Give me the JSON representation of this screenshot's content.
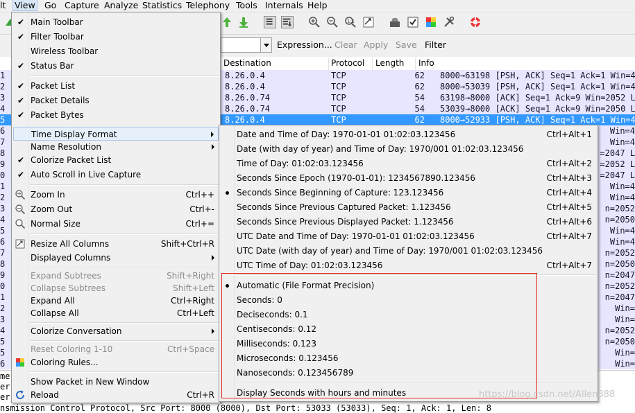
{
  "menubar": {
    "items": [
      "lt",
      "View",
      "Go",
      "Capture",
      "Analyze",
      "Statistics",
      "Telephony",
      "Tools",
      "Internals",
      "Help"
    ]
  },
  "filter": {
    "expression_label": "Expression...",
    "clear_label": "Clear",
    "apply_label": "Apply",
    "save_label": "Save",
    "filter_label": "Filter"
  },
  "packet_list": {
    "columns": [
      "Destination",
      "Protocol",
      "Length",
      "Info"
    ],
    "rows": [
      {
        "no": "1",
        "dest": "8.26.0.4",
        "proto": "TCP",
        "len": "62",
        "info": "8000→63198 [PSH, ACK] Seq=1 Ack=1 Win=4"
      },
      {
        "no": "2",
        "dest": "8.26.0.4",
        "proto": "TCP",
        "len": "62",
        "info": "8000→53039 [PSH, ACK] Seq=1 Ack=1 Win=4"
      },
      {
        "no": "3",
        "dest": "8.26.0.74",
        "proto": "TCP",
        "len": "54",
        "info": "63198→8000 [ACK] Seq=1 Ack=9 Win=2052 L"
      },
      {
        "no": "4",
        "dest": "8.26.0.74",
        "proto": "TCP",
        "len": "54",
        "info": "53039→8000 [ACK] Seq=1 Ack=9 Win=2050 L"
      },
      {
        "no": "5",
        "dest": "8.26.0.4",
        "proto": "TCP",
        "len": "62",
        "info": "8000→52933 [PSH, ACK] Seq=1 Ack=1 Win=4"
      },
      {
        "no": "6",
        "info": "Win=4"
      },
      {
        "no": "7",
        "info": "Win=4"
      },
      {
        "no": "8",
        "info": "=2047 L"
      },
      {
        "no": "9",
        "info": "=2052 L"
      },
      {
        "no": "0",
        "info": "=2047 L"
      },
      {
        "no": "1",
        "info": "Win=4"
      },
      {
        "no": "2",
        "info": "Win=4"
      },
      {
        "no": "3",
        "info": "n=2052"
      },
      {
        "no": "4",
        "info": "n=2050"
      },
      {
        "no": "5",
        "info": "Win=4"
      },
      {
        "no": "6",
        "info": "Win=4"
      },
      {
        "no": "7",
        "info": "n=2052"
      },
      {
        "no": "8",
        "info": "n=2050"
      },
      {
        "no": "9",
        "info": "n=2047"
      },
      {
        "no": "0",
        "info": "n=2052"
      },
      {
        "no": "1",
        "info": "n=2047"
      },
      {
        "no": "2",
        "info": "Win="
      },
      {
        "no": "3",
        "info": "Win="
      },
      {
        "no": "4",
        "info": "n=2052"
      },
      {
        "no": "5",
        "info": "n=2050"
      },
      {
        "no": "5",
        "info": "Win="
      },
      {
        "no": "6",
        "info": "Win="
      }
    ]
  },
  "details": {
    "lines": [
      "me",
      "err",
      "err",
      "nsmission Control Protocol, Src Port: 8000 (8000), Dst Port: 53033 (53033), Seq: 1, Ack: 1, Len: 8"
    ]
  },
  "view_menu": {
    "items": [
      {
        "label": "Main Toolbar",
        "checked": true
      },
      {
        "label": "Filter Toolbar",
        "checked": true
      },
      {
        "label": "Wireless Toolbar",
        "checked": false
      },
      {
        "label": "Status Bar",
        "checked": true
      },
      {
        "label": "Packet List",
        "checked": true
      },
      {
        "label": "Packet Details",
        "checked": true
      },
      {
        "label": "Packet Bytes",
        "checked": true
      },
      {
        "label": "Time Display Format",
        "submenu": true
      },
      {
        "label": "Name Resolution",
        "submenu": true
      },
      {
        "label": "Colorize Packet List",
        "checked": true
      },
      {
        "label": "Auto Scroll in Live Capture",
        "checked": true
      },
      {
        "label": "Zoom In",
        "shortcut": "Ctrl++",
        "icon": "zoom-in-icon"
      },
      {
        "label": "Zoom Out",
        "shortcut": "Ctrl+-",
        "icon": "zoom-out-icon"
      },
      {
        "label": "Normal Size",
        "shortcut": "Ctrl+=",
        "icon": "zoom-normal-icon"
      },
      {
        "label": "Resize All Columns",
        "shortcut": "Shift+Ctrl+R",
        "icon": "resize-columns-icon"
      },
      {
        "label": "Displayed Columns",
        "submenu": true
      },
      {
        "label": "Expand Subtrees",
        "shortcut": "Shift+Right",
        "disabled": true
      },
      {
        "label": "Collapse Subtrees",
        "shortcut": "Shift+Left",
        "disabled": true
      },
      {
        "label": "Expand All",
        "shortcut": "Ctrl+Right"
      },
      {
        "label": "Collapse All",
        "shortcut": "Ctrl+Left"
      },
      {
        "label": "Colorize Conversation",
        "submenu": true
      },
      {
        "label": "Reset Coloring 1-10",
        "shortcut": "Ctrl+Space",
        "disabled": true
      },
      {
        "label": "Coloring Rules...",
        "icon": "coloring-rules-icon"
      },
      {
        "label": "Show Packet in New Window"
      },
      {
        "label": "Reload",
        "shortcut": "Ctrl+R",
        "icon": "reload-icon"
      }
    ]
  },
  "time_menu": {
    "items": [
      {
        "label": "Date and Time of Day:   1970-01-01 01:02:03.123456",
        "shortcut": "Ctrl+Alt+1"
      },
      {
        "label": "Date (with day of year) and Time of Day:   1970/001 01:02:03.123456",
        "shortcut": ""
      },
      {
        "label": "Time of Day:   01:02:03.123456",
        "shortcut": "Ctrl+Alt+2"
      },
      {
        "label": "Seconds Since Epoch (1970-01-01):   1234567890.123456",
        "shortcut": "Ctrl+Alt+3"
      },
      {
        "label": "Seconds Since Beginning of Capture:   123.123456",
        "shortcut": "Ctrl+Alt+4",
        "selected": true
      },
      {
        "label": "Seconds Since Previous Captured Packet:   1.123456",
        "shortcut": "Ctrl+Alt+5"
      },
      {
        "label": "Seconds Since Previous Displayed Packet:   1.123456",
        "shortcut": "Ctrl+Alt+6"
      },
      {
        "label": "UTC Date and Time of Day:   1970-01-01 01:02:03.123456",
        "shortcut": "Ctrl+Alt+7"
      },
      {
        "label": "UTC Date (with day of year) and Time of Day:   1970/001 01:02:03.123456",
        "shortcut": ""
      },
      {
        "label": "UTC Time of Day:   01:02:03.123456",
        "shortcut": "Ctrl+Alt+7"
      },
      {
        "label": "Automatic (File Format Precision)",
        "selected": true
      },
      {
        "label": "Seconds:   0"
      },
      {
        "label": "Deciseconds:   0.1"
      },
      {
        "label": "Centiseconds:   0.12"
      },
      {
        "label": "Milliseconds:   0.123"
      },
      {
        "label": "Microseconds:   0.123456"
      },
      {
        "label": "Nanoseconds:   0.123456789"
      },
      {
        "label": "Display Seconds with hours and minutes"
      }
    ]
  },
  "watermark": "https://blog.csdn.net/Allen888",
  "colors": {
    "selected_row": "#3399ff",
    "row_bg": "#e7e6ff",
    "highlight_box": "#e8241b"
  }
}
